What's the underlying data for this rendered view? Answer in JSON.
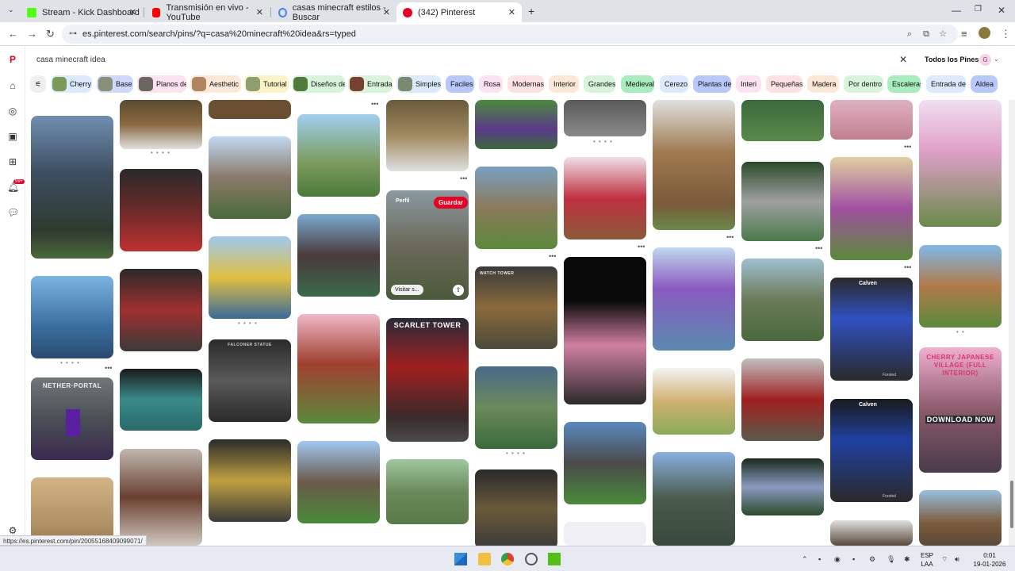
{
  "browser": {
    "tabs": [
      {
        "title": "Stream - Kick Dashboard",
        "close": "✕"
      },
      {
        "title": "Transmisión en vivo - YouTube",
        "close": "✕"
      },
      {
        "title": "casas minecraft estilos - Buscar",
        "close": "✕"
      },
      {
        "title": "(342) Pinterest",
        "close": "✕"
      }
    ],
    "new_tab": "+",
    "url": "es.pinterest.com/search/pins/?q=casa%20minecraft%20idea&rs=typed",
    "status_url": "https://es.pinterest.com/pin/20055168409099071/"
  },
  "pinterest": {
    "search_value": "casa minecraft idea",
    "clear_icon": "✕",
    "filter_label": "Todos los Pines",
    "avatar_letter": "G",
    "notif_badge": "99+",
    "chips": [
      {
        "label": "Cherry",
        "color": "#dbeafd",
        "thumb": "#7c9a55"
      },
      {
        "label": "Base",
        "color": "#cfd8fd",
        "thumb": "#8a8f7a"
      },
      {
        "label": "Planos de",
        "color": "#fde2f1",
        "thumb": "#6b6560"
      },
      {
        "label": "Aesthetic",
        "color": "#fde7d6",
        "thumb": "#b08560"
      },
      {
        "label": "Tutorial",
        "color": "#fdf3c7",
        "thumb": "#8fa070"
      },
      {
        "label": "Diseños de",
        "color": "#d8f5dc",
        "thumb": "#4f7a3c"
      },
      {
        "label": "Entrada",
        "color": "#d8f5dc",
        "thumb": "#7a4030"
      },
      {
        "label": "Simples",
        "color": "#dbeafd",
        "thumb": "#7a8a70"
      },
      {
        "label": "Faciles",
        "color": "#b9c8fa",
        "thumb": ""
      },
      {
        "label": "Rosa",
        "color": "#fde2f1",
        "thumb": ""
      },
      {
        "label": "Modernas",
        "color": "#fde2e2",
        "thumb": ""
      },
      {
        "label": "Interior",
        "color": "#fde7d6",
        "thumb": ""
      },
      {
        "label": "Grandes",
        "color": "#d8f5dc",
        "thumb": ""
      },
      {
        "label": "Medieval",
        "color": "#a8edbd",
        "thumb": ""
      },
      {
        "label": "Cerezo",
        "color": "#dbeafd",
        "thumb": ""
      },
      {
        "label": "Plantas de",
        "color": "#b9c8fa",
        "thumb": ""
      },
      {
        "label": "Interi",
        "color": "#fde2f1",
        "thumb": ""
      },
      {
        "label": "Pequeñas",
        "color": "#fde2e2",
        "thumb": ""
      },
      {
        "label": "Madera",
        "color": "#fde7d6",
        "thumb": ""
      },
      {
        "label": "Por dentro",
        "color": "#d8f5dc",
        "thumb": ""
      },
      {
        "label": "Escaleras",
        "color": "#a8edbd",
        "thumb": ""
      },
      {
        "label": "Entrada de",
        "color": "#dbeafd",
        "thumb": ""
      },
      {
        "label": "Aldea",
        "color": "#b9c8fa",
        "thumb": ""
      }
    ],
    "pin_texts": {
      "nether_portal": "NETHER·PORTAL",
      "scarlet_tower": "SCARLET TOWER",
      "cherry_village": "CHERRY JAPANESE VILLAGE (FULL INTERIOR)",
      "download_now": "DOWNLOAD NOW",
      "calven_1": "Calven",
      "calven_2": "Calven",
      "forsted_1": "Forsted",
      "forsted_2": "Forsted",
      "perfil": "Perfil",
      "save": "Guardar",
      "visit": "Visitar s...",
      "watch_tower": "WATCH TOWER",
      "falconer": "FALCONER STATUE"
    }
  },
  "taskbar": {
    "lang_1": "ESP",
    "lang_2": "LAA",
    "time": "0:01",
    "date": "19-01-2026"
  }
}
